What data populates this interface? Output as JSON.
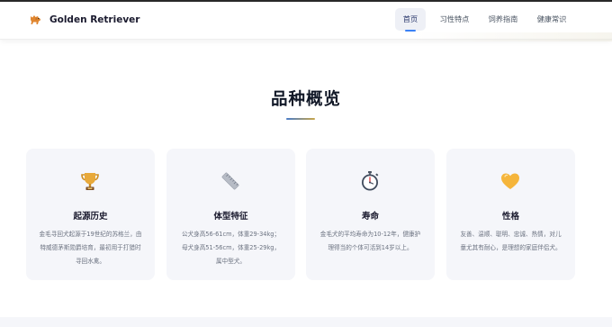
{
  "header": {
    "brand": "Golden Retriever",
    "logo_icon": "dog-icon",
    "nav": [
      {
        "label": "首页",
        "active": true
      },
      {
        "label": "习性特点",
        "active": false
      },
      {
        "label": "饲养指南",
        "active": false
      },
      {
        "label": "健康常识",
        "active": false
      }
    ]
  },
  "section": {
    "title": "品种概览"
  },
  "cards": [
    {
      "icon": "trophy-icon",
      "title": "起源历史",
      "desc": "金毛寻回犬起源于19世纪的苏格兰，由特威德茅斯勋爵培育，最初用于打猎时寻回水禽。"
    },
    {
      "icon": "ruler-icon",
      "title": "体型特征",
      "desc": "公犬身高56-61cm，体重29-34kg；母犬身高51-56cm，体重25-29kg，属中型犬。"
    },
    {
      "icon": "stopwatch-icon",
      "title": "寿命",
      "desc": "金毛犬的平均寿命为10-12年，健康护理得当的个体可活到14岁以上。"
    },
    {
      "icon": "heart-icon",
      "title": "性格",
      "desc": "友善、温顺、聪明、忠诚、热情，对儿童尤其有耐心，是理想的家庭伴侣犬。"
    }
  ],
  "colors": {
    "accent": "#3b82f6",
    "card_bg": "#f5f6fa",
    "title_bar_start": "#4a7dc9",
    "title_bar_end": "#c9a64a"
  }
}
